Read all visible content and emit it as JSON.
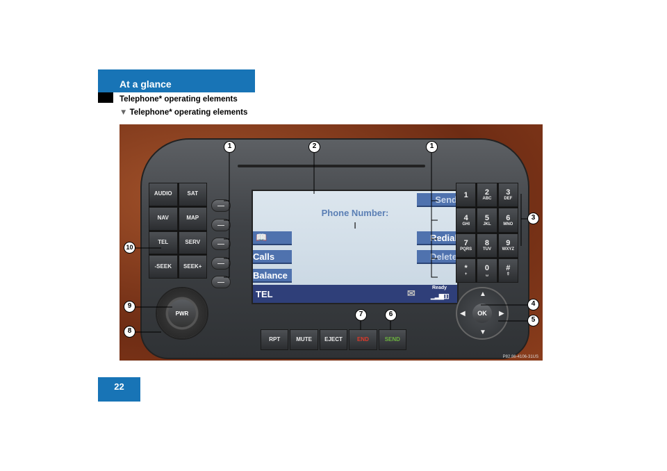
{
  "header": {
    "section": "At a glance",
    "title": "Telephone* operating elements",
    "subtitle": "Telephone* operating elements"
  },
  "page_number": "22",
  "colors": {
    "brand_blue": "#1874b6",
    "screen_button": "#4f72ae",
    "end": "#e03a2a",
    "send": "#6cb33f"
  },
  "figure": {
    "function_buttons": [
      "AUDIO",
      "SAT",
      "NAV",
      "MAP",
      "TEL",
      "SERV",
      "-SEEK",
      "SEEK+"
    ],
    "knob": "PWR",
    "screen": {
      "title": "Phone Number:",
      "cursor": "I",
      "left_softkeys": [
        "phonebook-icon",
        "Calls",
        "Balance"
      ],
      "right_softkeys": [
        "Send",
        "Redial",
        "Delete"
      ],
      "mode": "TEL",
      "status": "Ready",
      "icons": [
        "envelope-icon",
        "signal-strength-icon"
      ]
    },
    "keypad": [
      [
        "1",
        ""
      ],
      [
        "2",
        "ABC"
      ],
      [
        "3",
        "DEF"
      ],
      [
        "4",
        "GHI"
      ],
      [
        "5",
        "JKL"
      ],
      [
        "6",
        "MNO"
      ],
      [
        "7",
        "PQRS"
      ],
      [
        "8",
        "TUV"
      ],
      [
        "9",
        "WXYZ"
      ],
      [
        "*",
        "+"
      ],
      [
        "0",
        "␣"
      ],
      [
        "#",
        "⇧"
      ]
    ],
    "nav": {
      "center": "OK"
    },
    "bottom_buttons": [
      "RPT",
      "MUTE",
      "EJECT",
      "END",
      "SEND"
    ],
    "callouts": [
      "1",
      "2",
      "1",
      "3",
      "4",
      "5",
      "6",
      "7",
      "8",
      "9",
      "10"
    ],
    "code": "P82.86-4106-31US"
  }
}
